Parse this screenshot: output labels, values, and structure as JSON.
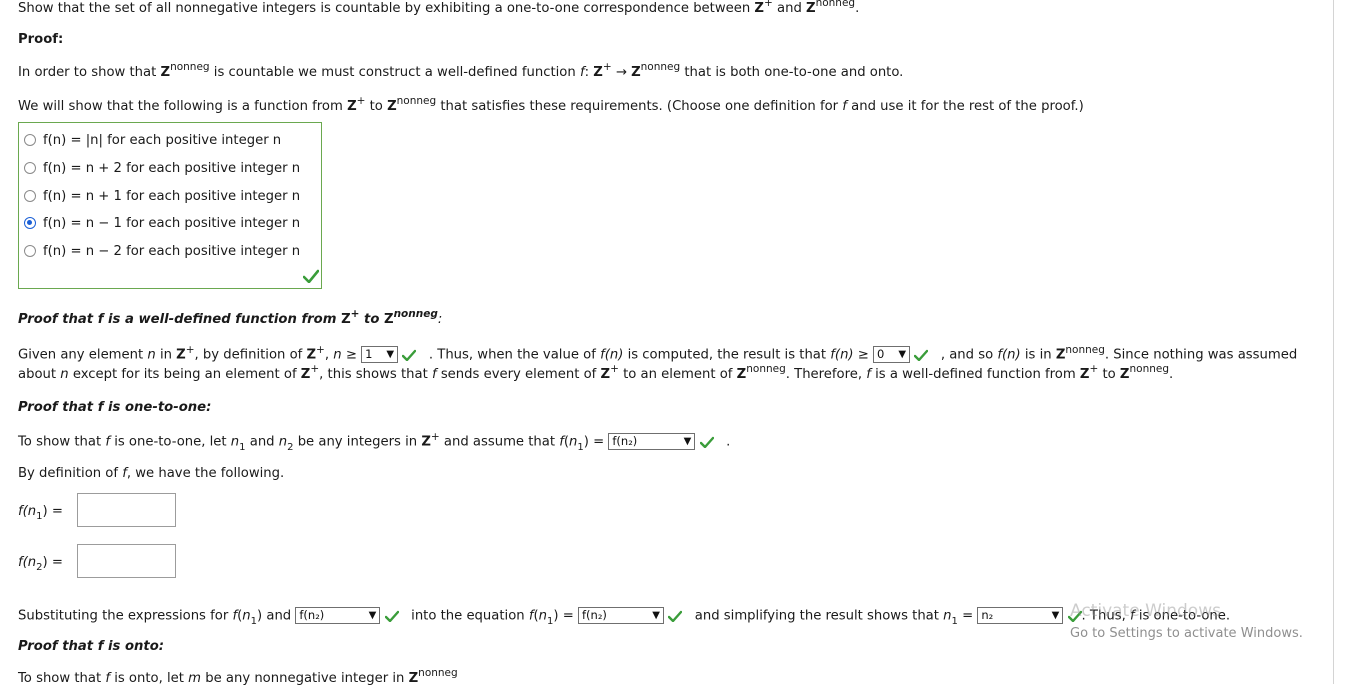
{
  "intro": {
    "prefix": "Show that the set of all nonnegative integers is countable by exhibiting a one-to-one correspondence between",
    "z": "Z",
    "sup_plus": "+",
    "and": "and",
    "sup_nonneg": "nonneg",
    "period": "."
  },
  "proof_label": "Proof:",
  "p1": {
    "a": "In order to show that",
    "b": "is countable we must construct a well-defined function",
    "f": "f",
    "colon": ":",
    "arrow": "→",
    "c": "that is both one-to-one and onto."
  },
  "p2": {
    "a": "We will show that the following is a function from",
    "to": "to",
    "b": "that satisfies these requirements. (Choose one definition for",
    "c": "and use it for the rest of the proof.)"
  },
  "options": [
    {
      "text": "f(n) = |n| for each positive integer n",
      "selected": false
    },
    {
      "text": "f(n) = n + 2 for each positive integer n",
      "selected": false
    },
    {
      "text": "f(n) = n + 1 for each positive integer n",
      "selected": false
    },
    {
      "text": "f(n) = n − 1 for each positive integer n",
      "selected": true
    },
    {
      "text": "f(n) = n − 2 for each positive integer n",
      "selected": false
    }
  ],
  "wd": {
    "heading_a": "Proof that f is a well-defined function from",
    "heading_to": "to",
    "l1_a": "Given any element",
    "n": "n",
    "l1_in": "in",
    "l1_b": ", by definition of",
    "l1_c": ",",
    "geq": "≥",
    "sel1": "1",
    "l1_d": ". Thus, when the value of",
    "fn": "f(n)",
    "l1_e": "is computed, the result is that",
    "sel2": "0",
    "l1_f": ", and so",
    "l1_g": "is in",
    "l1_h": ". Since nothing was assumed",
    "l2_a": "about",
    "l2_b": "except for its being an element of",
    "l2_c": ", this shows that",
    "l2_d": "sends every element of",
    "l2_e": "to an element of",
    "l2_f": ". Therefore,",
    "l2_g": "is a well-defined function from",
    "l2_h": "to"
  },
  "oto": {
    "heading": "Proof that f is one-to-one:",
    "l1_a": "To show that",
    "l1_b": "is one-to-one, let",
    "n": "n",
    "s1": "1",
    "s2": "2",
    "l1_c": "and",
    "l1_d": "be any integers in",
    "l1_e": "and assume that",
    "f": "f",
    "eq": "=",
    "sel": "f(n₂)",
    "dot": ".",
    "l2": "By definition of",
    "l2_b": ", we have the following.",
    "fn1_label": "f(n",
    "fn2_label": "f(n",
    "close": ") =",
    "fn1_value": "",
    "fn2_value": "",
    "sub_a": "Substituting the expressions for",
    "sub_and": "and",
    "sub_sel1": "f(n₂)",
    "sub_b": "into the equation",
    "sub_sel2": "f(n₂)",
    "sub_c": "and simplifying the result shows that",
    "sub_sel3": "n₂",
    "sub_d": ". Thus,",
    "sub_e": "is one-to-one."
  },
  "onto": {
    "heading": "Proof that f is onto:",
    "l1_a": "To show that",
    "l1_b": "is onto, let",
    "m": "m",
    "l1_c": "be any nonnegative integer in"
  },
  "watermark": {
    "title": "Activate Windows",
    "sub": "Go to Settings to activate Windows."
  },
  "colors": {
    "check": "#3a9d3a",
    "box_border": "#6aa84f",
    "radio_selected": "#1a5fd6"
  }
}
